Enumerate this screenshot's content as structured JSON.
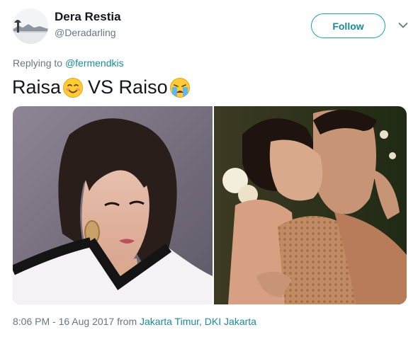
{
  "user": {
    "display_name": "Dera Restia",
    "handle": "@Deradarling",
    "avatar_icon": "landscape-avatar-icon"
  },
  "follow_button": {
    "label": "Follow"
  },
  "more_menu": {
    "icon": "chevron-down-icon"
  },
  "reply": {
    "prefix": "Replying to",
    "mention": "@fermendkis"
  },
  "tweet": {
    "text_part1": "Raisa",
    "emoji1": "smiling-face-with-smiling-eyes-emoji",
    "text_part2": "VS Raiso",
    "emoji2": "loudly-crying-face-emoji"
  },
  "media": [
    {
      "name": "photo-portrait"
    },
    {
      "name": "photo-couple"
    }
  ],
  "timestamp": {
    "time_date": "8:06 PM - 16 Aug 2017",
    "from_label": "from",
    "location": "Jakarta Timur, DKI Jakarta"
  },
  "colors": {
    "accent": "#1a8a9a",
    "secondary_text": "#657786"
  }
}
